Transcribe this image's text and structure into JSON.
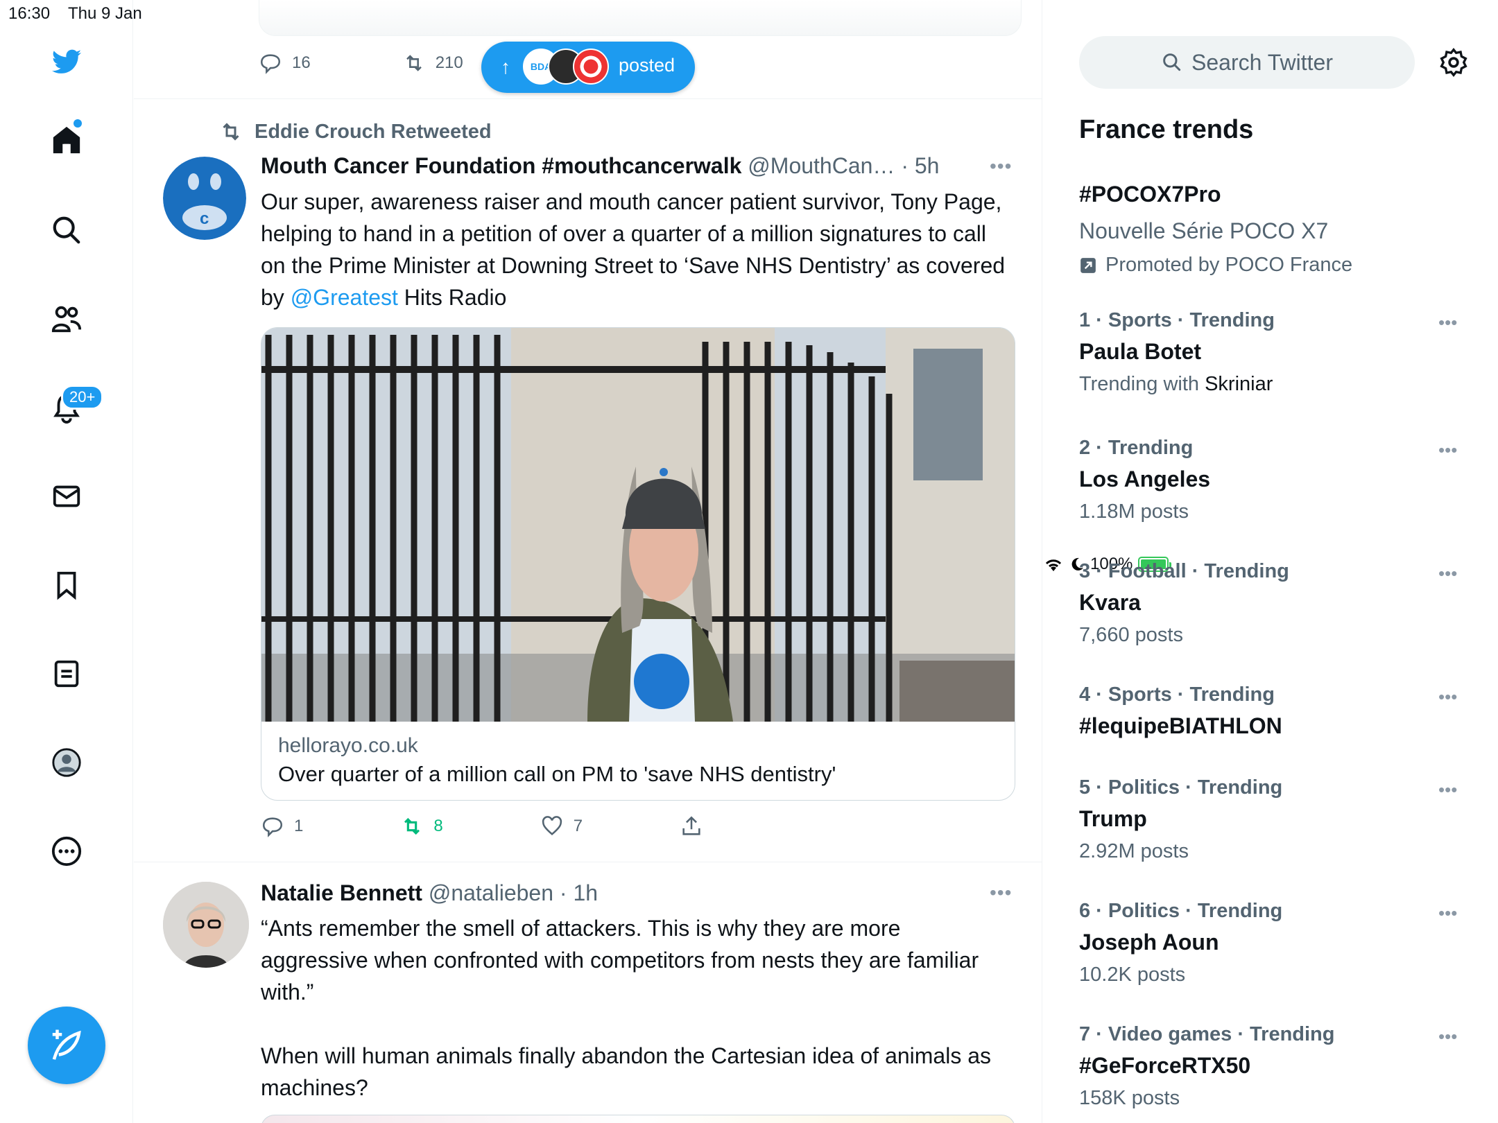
{
  "status_bar": {
    "time": "16:30",
    "date": "Thu 9 Jan",
    "battery": "100%"
  },
  "nav": {
    "notifications_badge": "20+"
  },
  "prev_tweet": {
    "replies": "16",
    "retweets": "210"
  },
  "new_posts_pill": {
    "label": "posted",
    "avatar_text": "BDA"
  },
  "tweet1": {
    "retweeted_by": "Eddie Crouch Retweeted",
    "name": "Mouth Cancer Foundation #mouthcancerwalk",
    "handle": "@MouthCan…",
    "time": "· 5h",
    "text_a": "Our super, awareness raiser and mouth cancer patient survivor, Tony Page, helping to hand in a petition of over a quarter of a million signatures to call on the Prime Minister at Downing Street to ‘Save NHS Dentistry’ as covered by ",
    "mention": "@Greatest",
    "text_b": " Hits Radio",
    "card_domain": "hellorayo.co.uk",
    "card_title": "Over quarter of a million call on PM to 'save NHS dentistry'",
    "replies": "1",
    "retweets": "8",
    "likes": "7"
  },
  "tweet2": {
    "name": "Natalie Bennett",
    "handle": "@natalieben",
    "time": "· 1h",
    "text_a": "“Ants remember the smell of attackers. This is why they are more aggressive when confronted with competitors from nests they are familiar with.”",
    "text_b": "When will human animals finally abandon the Cartesian idea of animals as machines?"
  },
  "sidebar": {
    "search_placeholder": "Search Twitter",
    "trends_title": "France trends",
    "promoted": {
      "topic": "#POCOX7Pro",
      "description": "Nouvelle Série POCO X7",
      "promoted_by": "Promoted by POCO France"
    },
    "trends": [
      {
        "meta": "1 · Sports · Trending",
        "topic": "Paula Botet",
        "sub_prefix": "Trending with ",
        "sub_term": "Skriniar"
      },
      {
        "meta": "2 · Trending",
        "topic": "Los Angeles",
        "sub": "1.18M posts"
      },
      {
        "meta": "3 · Football · Trending",
        "topic": "Kvara",
        "sub": "7,660 posts"
      },
      {
        "meta": "4 · Sports · Trending",
        "topic": "#lequipeBIATHLON"
      },
      {
        "meta": "5 · Politics · Trending",
        "topic": "Trump",
        "sub": "2.92M posts"
      },
      {
        "meta": "6 · Politics · Trending",
        "topic": "Joseph Aoun",
        "sub": "10.2K posts"
      },
      {
        "meta": "7 · Video games · Trending",
        "topic": "#GeForceRTX50",
        "sub": "158K posts"
      }
    ]
  },
  "colors": {
    "accent": "#1d9bf0",
    "retweet_green": "#00ba7c",
    "muted": "#536471"
  }
}
